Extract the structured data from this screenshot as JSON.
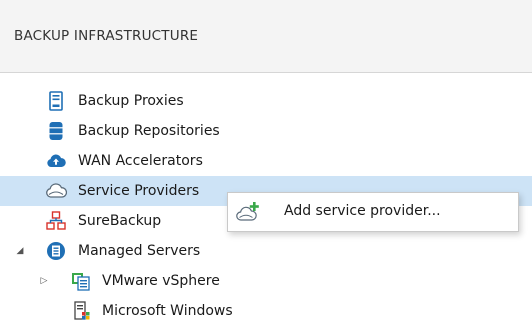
{
  "header": {
    "title": "BACKUP INFRASTRUCTURE"
  },
  "tree": {
    "items": [
      {
        "label": "Backup Proxies",
        "icon": "server-icon"
      },
      {
        "label": "Backup Repositories",
        "icon": "database-icon"
      },
      {
        "label": "WAN Accelerators",
        "icon": "cloud-upload-icon"
      },
      {
        "label": "Service Providers",
        "icon": "cloud-icon",
        "selected": true
      },
      {
        "label": "SureBackup",
        "icon": "network-icon"
      },
      {
        "label": "Managed Servers",
        "icon": "managed-servers-icon",
        "expanded": true
      },
      {
        "label": "VMware vSphere",
        "icon": "vsphere-icon",
        "expanded": false
      },
      {
        "label": "Microsoft Windows",
        "icon": "windows-server-icon"
      }
    ]
  },
  "context_menu": {
    "items": [
      {
        "label": "Add service provider...",
        "icon": "cloud-add-icon"
      }
    ]
  },
  "colors": {
    "selection": "#cde3f6",
    "icon_blue": "#1f6fb5",
    "icon_green": "#3aa84a",
    "icon_red": "#d9322b"
  }
}
